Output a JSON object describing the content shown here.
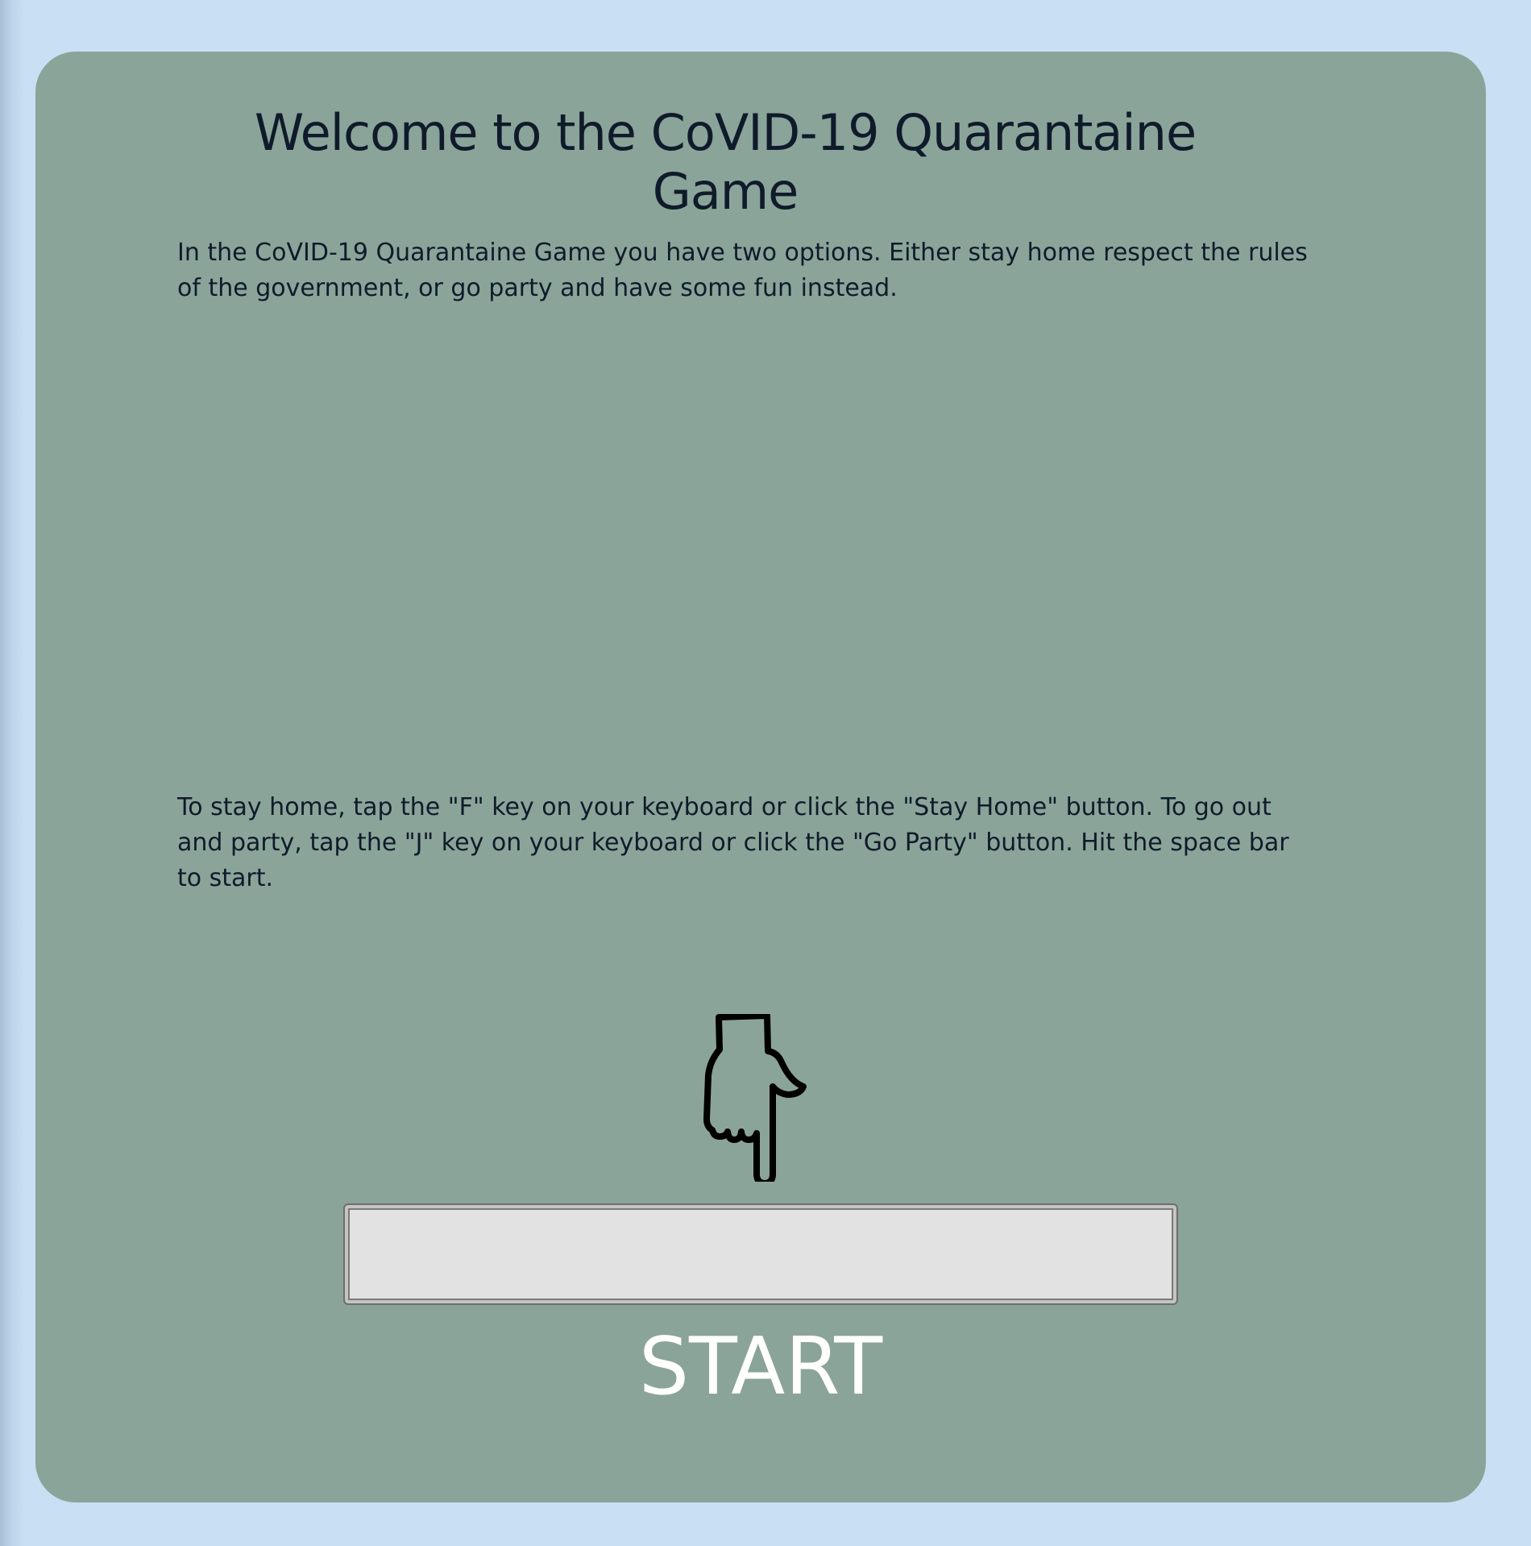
{
  "page": {
    "background_color": "#c9dff3",
    "card_color": "#8ba499",
    "text_color": "#0f1b2a"
  },
  "welcome": {
    "title": "Welcome to the CoVID-19 Quarantaine Game",
    "intro": "In the CoVID-19 Quarantaine Game you have two options. Either stay home respect the rules of the government, or go party and have some fun instead.",
    "instructions": "To stay home, tap the \"F\" key on your keyboard or click the \"Stay Home\" button. To go out and party, tap the \"J\" key on your keyboard or click the \"Go Party\" button. Hit the space bar to start."
  },
  "start": {
    "pointer_icon": "pointing-down-hand-icon",
    "label": "START"
  }
}
